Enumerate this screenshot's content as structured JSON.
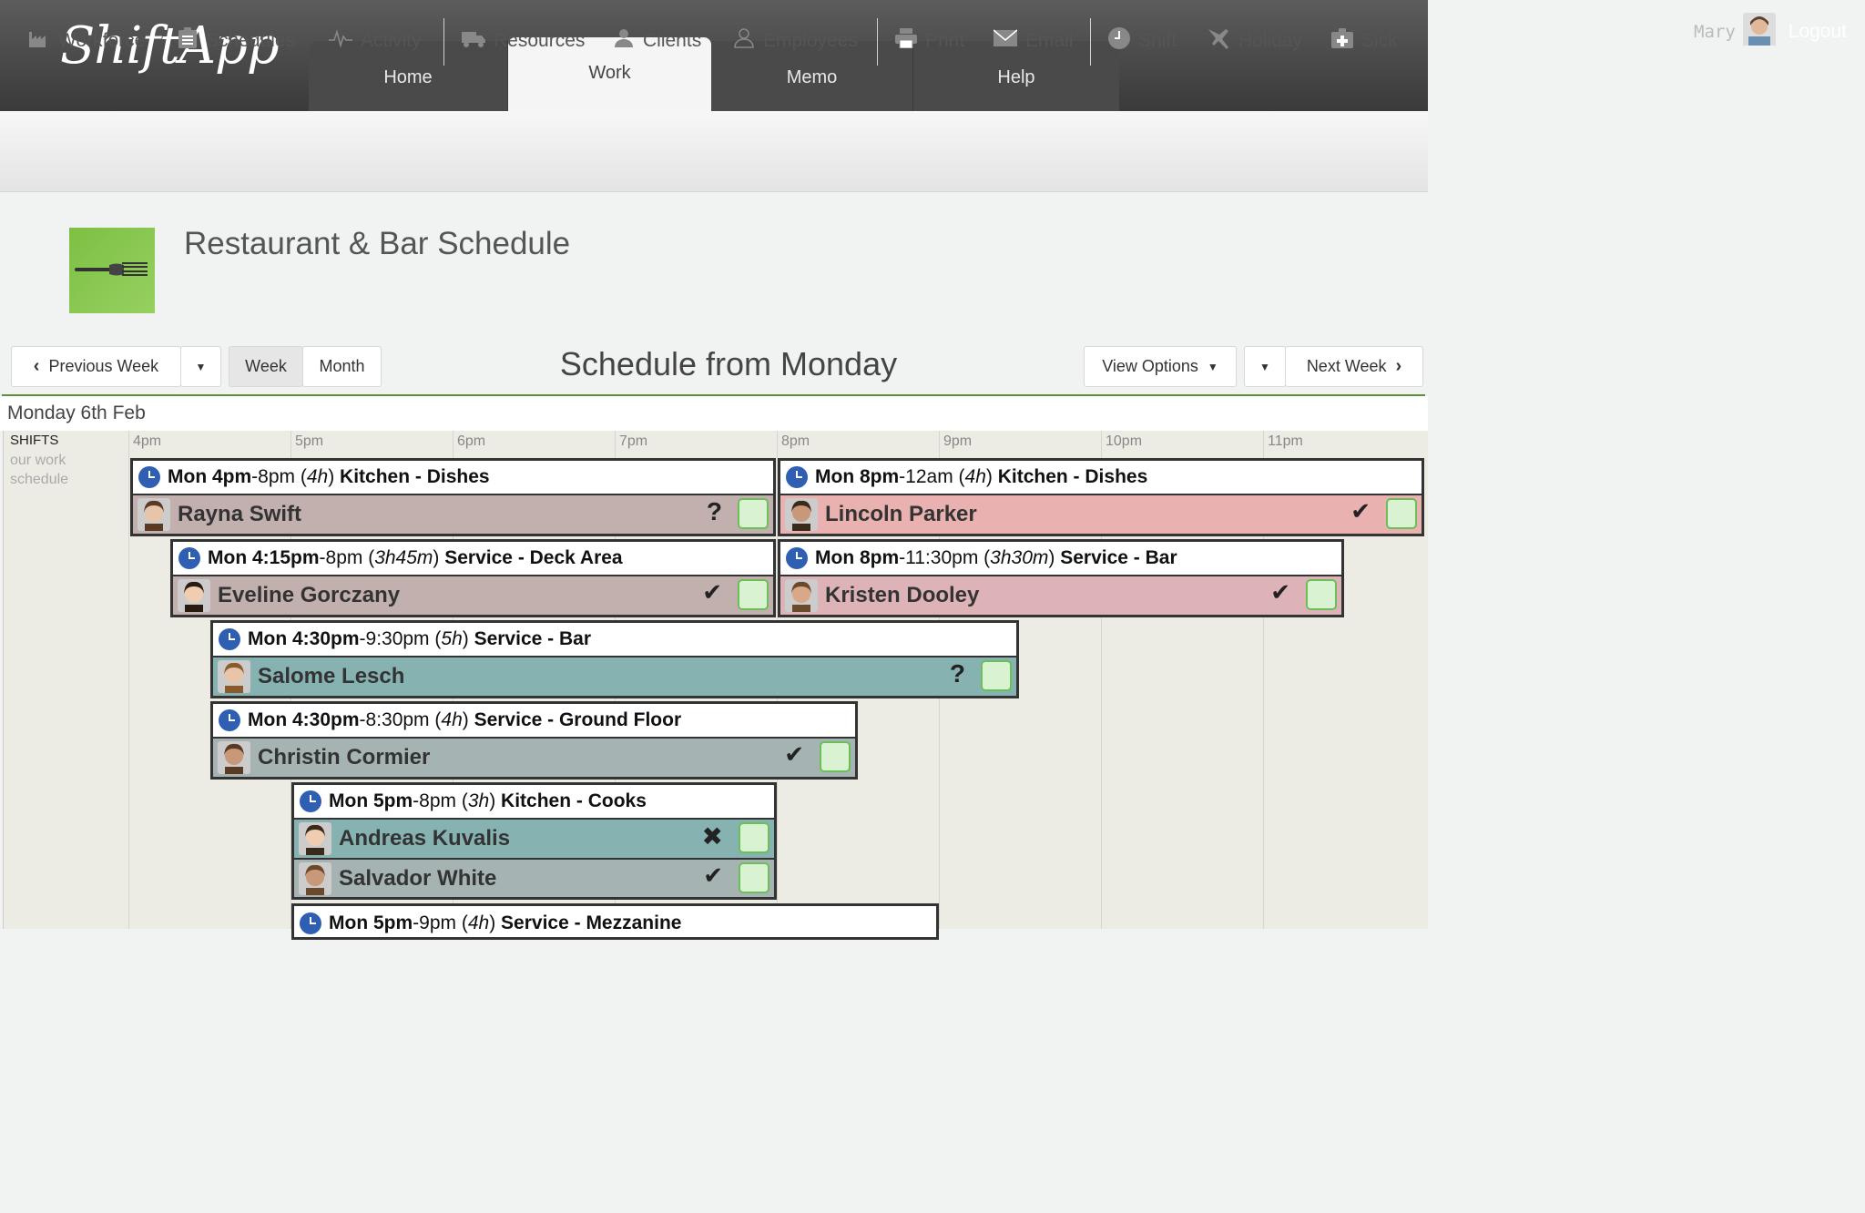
{
  "app": {
    "logo": "ShiftApp"
  },
  "nav": {
    "tabs": [
      "Home",
      "Work",
      "Memo",
      "Help"
    ],
    "active": "Work"
  },
  "user": {
    "name": "Mary",
    "logout": "Logout"
  },
  "toolbar": [
    {
      "label": "Workforce",
      "icon": "factory-icon"
    },
    {
      "label": "Schedules",
      "icon": "clipboard-icon"
    },
    {
      "label": "Activity",
      "icon": "pulse-icon"
    },
    {
      "label": "Resources",
      "icon": "truck-icon"
    },
    {
      "label": "Clients",
      "icon": "clients-icon"
    },
    {
      "label": "Employees",
      "icon": "person-icon"
    },
    {
      "label": "Print",
      "icon": "printer-icon"
    },
    {
      "label": "Email",
      "icon": "envelope-icon"
    },
    {
      "label": "Shift",
      "icon": "clock-icon"
    },
    {
      "label": "Holiday",
      "icon": "plane-icon"
    },
    {
      "label": "Sick",
      "icon": "medkit-icon"
    }
  ],
  "page": {
    "title": "Restaurant & Bar Schedule"
  },
  "controls": {
    "prev": "Previous Week",
    "week": "Week",
    "month": "Month",
    "heading": "Schedule from Monday",
    "view_options": "View Options",
    "next": "Next Week"
  },
  "schedule": {
    "day": "Monday 6th Feb",
    "side_title": "SHIFTS",
    "side_sub": "our work schedule",
    "hours": [
      "4pm",
      "5pm",
      "6pm",
      "7pm",
      "8pm",
      "9pm",
      "10pm",
      "11pm"
    ],
    "shifts": [
      {
        "start": "Mon 4pm",
        "end": "8pm",
        "dur": "4h",
        "area": "Kitchen - Dishes",
        "emps": [
          {
            "name": "Rayna Swift",
            "status": "?",
            "color": "#c2b0ae"
          }
        ]
      },
      {
        "start": "Mon 8pm",
        "end": "12am",
        "dur": "4h",
        "area": "Kitchen - Dishes",
        "emps": [
          {
            "name": "Lincoln Parker",
            "status": "✔",
            "color": "#e9b2b0"
          }
        ]
      },
      {
        "start": "Mon 4:15pm",
        "end": "8pm",
        "dur": "3h45m",
        "area": "Service - Deck Area",
        "emps": [
          {
            "name": "Eveline Gorczany",
            "status": "✔",
            "color": "#c2b0ae"
          }
        ]
      },
      {
        "start": "Mon 8pm",
        "end": "11:30pm",
        "dur": "3h30m",
        "area": "Service - Bar",
        "emps": [
          {
            "name": "Kristen Dooley",
            "status": "✔",
            "color": "#ddb3b7"
          }
        ]
      },
      {
        "start": "Mon 4:30pm",
        "end": "9:30pm",
        "dur": "5h",
        "area": "Service - Bar",
        "emps": [
          {
            "name": "Salome Lesch",
            "status": "?",
            "color": "#86b3b1"
          }
        ]
      },
      {
        "start": "Mon 4:30pm",
        "end": "8:30pm",
        "dur": "4h",
        "area": "Service - Ground Floor",
        "emps": [
          {
            "name": "Christin Cormier",
            "status": "✔",
            "color": "#a5b4b2"
          }
        ]
      },
      {
        "start": "Mon 5pm",
        "end": "8pm",
        "dur": "3h",
        "area": "Kitchen - Cooks",
        "emps": [
          {
            "name": "Andreas Kuvalis",
            "status": "✖",
            "color": "#86b3b1"
          },
          {
            "name": "Salvador White",
            "status": "✔",
            "color": "#a5b4b2"
          }
        ]
      },
      {
        "start": "Mon 5pm",
        "end": "9pm",
        "dur": "4h",
        "area": "Service - Mezzanine",
        "emps": []
      }
    ]
  }
}
